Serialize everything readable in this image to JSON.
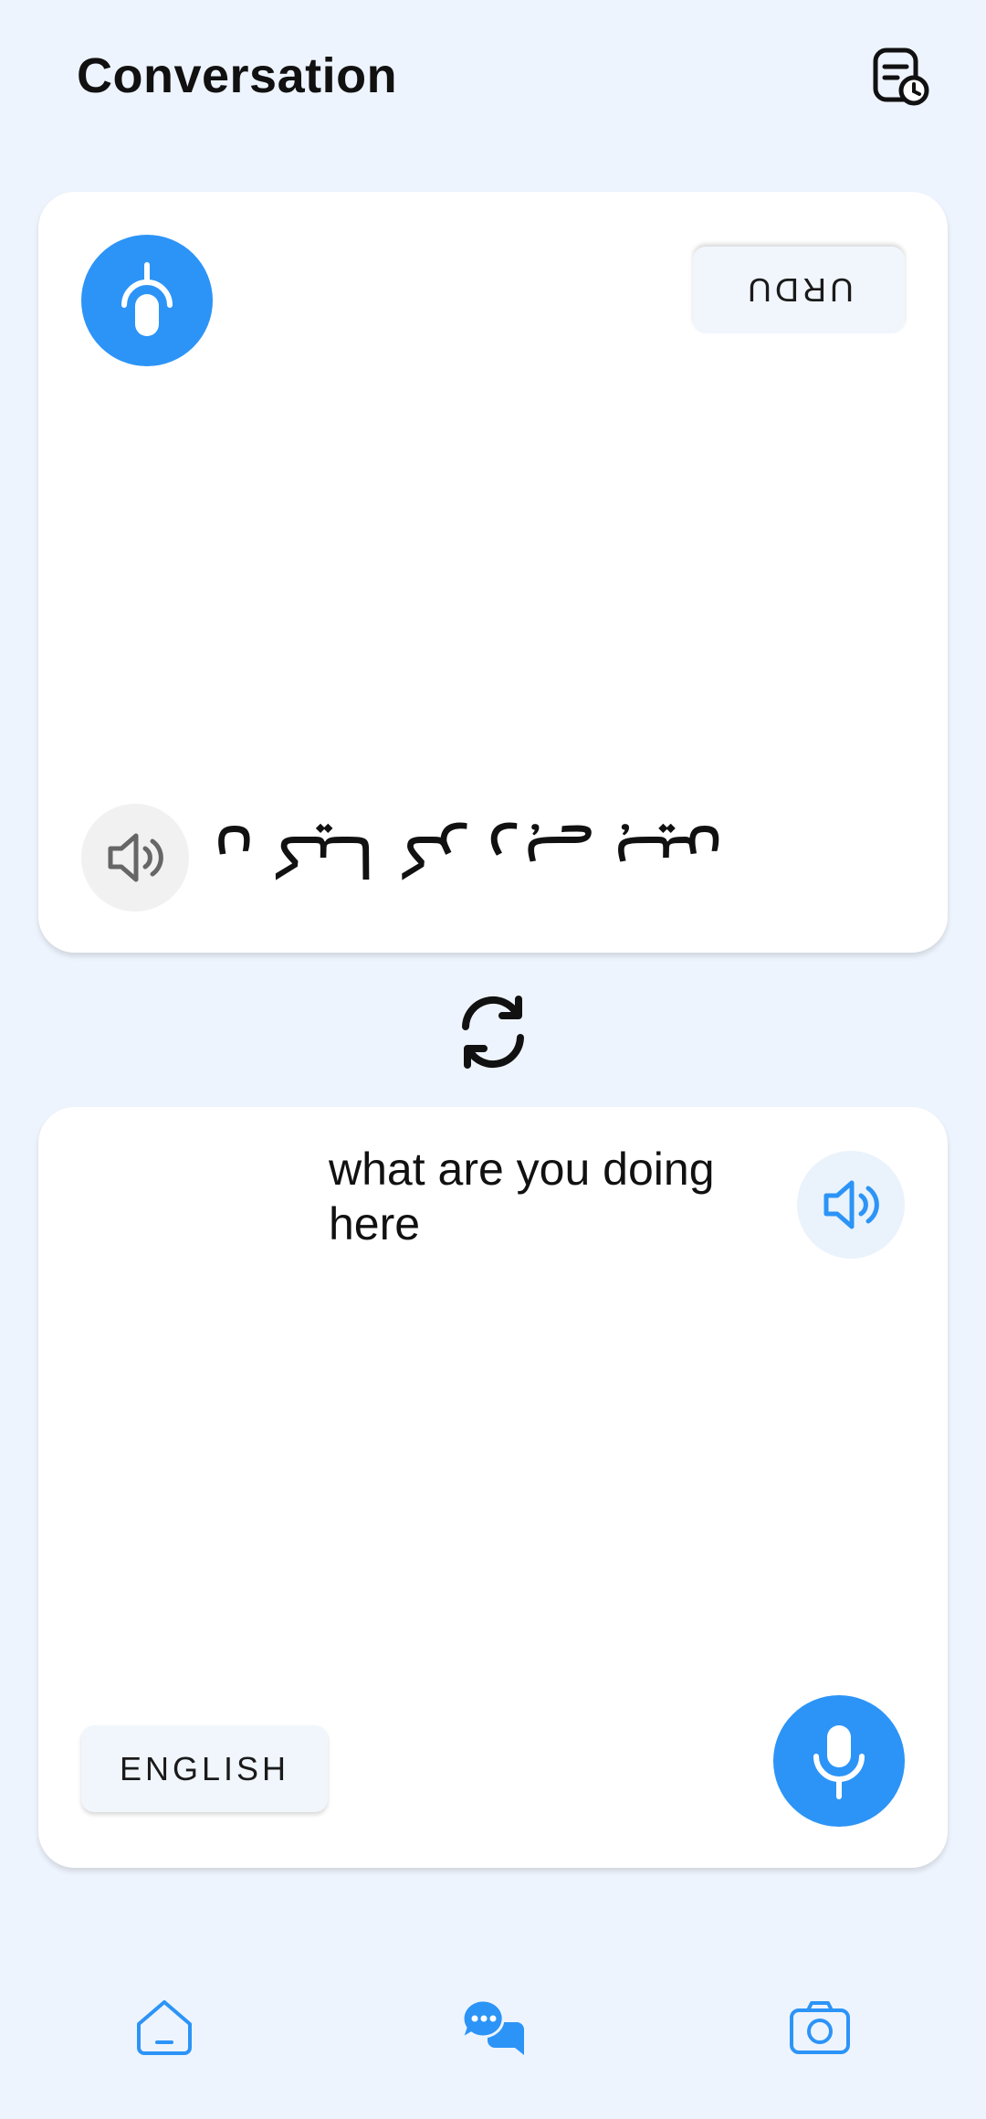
{
  "header": {
    "title": "Conversation",
    "history_icon": "history-icon"
  },
  "top_panel": {
    "language": "URDU",
    "translated_text": "آپ یہاں کیا کر رہے ہیں",
    "mic_icon": "microphone-icon",
    "speaker_icon": "speaker-icon"
  },
  "swap_icon": "swap-icon",
  "bottom_panel": {
    "language": "ENGLISH",
    "source_text": "what are you doing here",
    "mic_icon": "microphone-icon",
    "speaker_icon": "speaker-icon"
  },
  "nav": {
    "items": [
      {
        "icon": "home-icon",
        "active": false
      },
      {
        "icon": "chat-icon",
        "active": true
      },
      {
        "icon": "camera-icon",
        "active": false
      }
    ]
  },
  "colors": {
    "accent": "#2C94F7",
    "background": "#EEF4FD",
    "card": "#FFFFFF"
  }
}
